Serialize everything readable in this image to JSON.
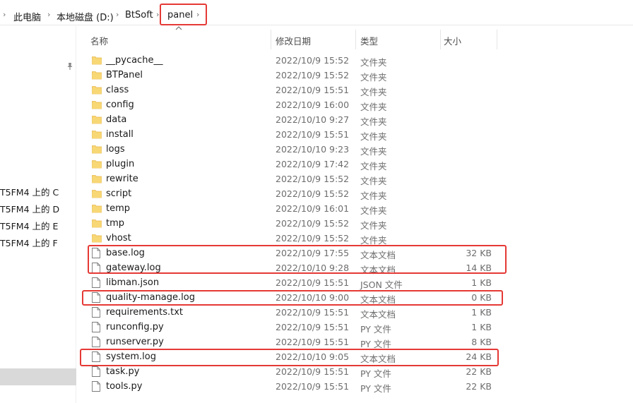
{
  "address_bar": {
    "segments": [
      "此电脑",
      "本地磁盘 (D:)",
      "BtSoft",
      "panel"
    ],
    "separator": "›"
  },
  "nav": {
    "drives": [
      "T5FM4 上的 C",
      "T5FM4 上的 D",
      "T5FM4 上的 E",
      "T5FM4 上的 F"
    ]
  },
  "columns": {
    "name": "名称",
    "date": "修改日期",
    "type": "类型",
    "size": "大小"
  },
  "files": [
    {
      "name": "__pycache__",
      "date": "2022/10/9 15:52",
      "type": "文件夹",
      "size": "",
      "kind": "folder"
    },
    {
      "name": "BTPanel",
      "date": "2022/10/9 15:52",
      "type": "文件夹",
      "size": "",
      "kind": "folder"
    },
    {
      "name": "class",
      "date": "2022/10/9 15:51",
      "type": "文件夹",
      "size": "",
      "kind": "folder"
    },
    {
      "name": "config",
      "date": "2022/10/9 16:00",
      "type": "文件夹",
      "size": "",
      "kind": "folder"
    },
    {
      "name": "data",
      "date": "2022/10/10 9:27",
      "type": "文件夹",
      "size": "",
      "kind": "folder"
    },
    {
      "name": "install",
      "date": "2022/10/9 15:51",
      "type": "文件夹",
      "size": "",
      "kind": "folder"
    },
    {
      "name": "logs",
      "date": "2022/10/10 9:23",
      "type": "文件夹",
      "size": "",
      "kind": "folder"
    },
    {
      "name": "plugin",
      "date": "2022/10/9 17:42",
      "type": "文件夹",
      "size": "",
      "kind": "folder"
    },
    {
      "name": "rewrite",
      "date": "2022/10/9 15:52",
      "type": "文件夹",
      "size": "",
      "kind": "folder"
    },
    {
      "name": "script",
      "date": "2022/10/9 15:52",
      "type": "文件夹",
      "size": "",
      "kind": "folder"
    },
    {
      "name": "temp",
      "date": "2022/10/9 16:01",
      "type": "文件夹",
      "size": "",
      "kind": "folder"
    },
    {
      "name": "tmp",
      "date": "2022/10/9 15:52",
      "type": "文件夹",
      "size": "",
      "kind": "folder"
    },
    {
      "name": "vhost",
      "date": "2022/10/9 15:52",
      "type": "文件夹",
      "size": "",
      "kind": "folder"
    },
    {
      "name": "base.log",
      "date": "2022/10/9 17:55",
      "type": "文本文档",
      "size": "32 KB",
      "kind": "file"
    },
    {
      "name": "gateway.log",
      "date": "2022/10/10 9:28",
      "type": "文本文档",
      "size": "14 KB",
      "kind": "file"
    },
    {
      "name": "libman.json",
      "date": "2022/10/9 15:51",
      "type": "JSON 文件",
      "size": "1 KB",
      "kind": "file"
    },
    {
      "name": "quality-manage.log",
      "date": "2022/10/10 9:00",
      "type": "文本文档",
      "size": "0 KB",
      "kind": "file"
    },
    {
      "name": "requirements.txt",
      "date": "2022/10/9 15:51",
      "type": "文本文档",
      "size": "1 KB",
      "kind": "file"
    },
    {
      "name": "runconfig.py",
      "date": "2022/10/9 15:51",
      "type": "PY 文件",
      "size": "1 KB",
      "kind": "file"
    },
    {
      "name": "runserver.py",
      "date": "2022/10/9 15:51",
      "type": "PY 文件",
      "size": "8 KB",
      "kind": "file"
    },
    {
      "name": "system.log",
      "date": "2022/10/10 9:05",
      "type": "文本文档",
      "size": "24 KB",
      "kind": "file"
    },
    {
      "name": "task.py",
      "date": "2022/10/9 15:51",
      "type": "PY 文件",
      "size": "22 KB",
      "kind": "file"
    },
    {
      "name": "tools.py",
      "date": "2022/10/9 15:51",
      "type": "PY 文件",
      "size": "22 KB",
      "kind": "file"
    }
  ],
  "colors": {
    "highlight_box": "#e53935",
    "folder": "#f8d775",
    "folder_dark": "#e8b84a",
    "nav_selected": "#d9d9d9"
  }
}
